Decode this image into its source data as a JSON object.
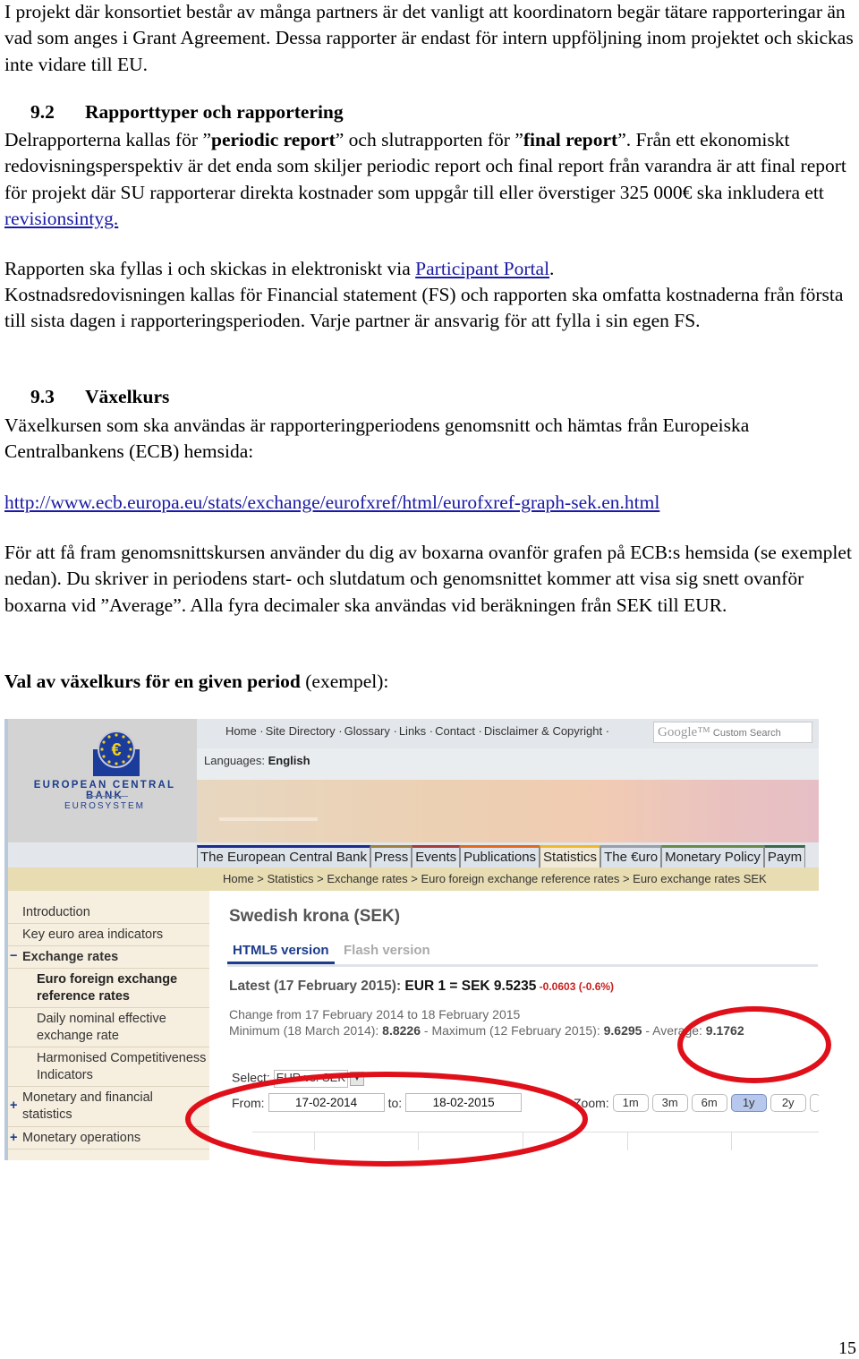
{
  "intro": "I projekt där konsortiet består av många partners är det vanligt att koordinatorn begär tätare rapporteringar än vad som anges i Grant Agreement. Dessa rapporter är endast för intern uppföljning inom projektet och skickas inte vidare till EU.",
  "section_92": {
    "number": "9.2",
    "title": "Rapporttyper och rapportering",
    "p1_a": "Delrapporterna kallas för ”",
    "p1_b": "periodic report",
    "p1_c": "” och slutrapporten för ”",
    "p1_d": "final report",
    "p1_e": "”. Från ett ekonomiskt redovisningsperspektiv är det enda som skiljer periodic report och final report från varandra är att final report för projekt där SU rapporterar direkta kostnader som uppgår till eller överstiger 325 000€ ska inkludera ett ",
    "p1_link": "revisionsintyg.",
    "p2_a": "Rapporten ska fyllas i och skickas in elektroniskt via ",
    "p2_link": "Participant Portal",
    "p2_b": ".",
    "p3": "Kostnadsredovisningen kallas för Financial statement (FS) och rapporten ska omfatta kostnaderna från första till sista dagen i rapporteringsperioden. Varje partner är ansvarig för att fylla i sin egen FS."
  },
  "section_93": {
    "number": "9.3",
    "title": "Växelkurs",
    "p1": "Växelkursen som ska användas är rapporteringperiodens genomsnitt och hämtas från Europeiska Centralbankens (ECB) hemsida:",
    "url": "http://www.ecb.europa.eu/stats/exchange/eurofxref/html/eurofxref-graph-sek.en.html",
    "p2": "För att få fram genomsnittskursen använder du dig av boxarna ovanför grafen på ECB:s hemsida (se exemplet nedan). Du skriver in periodens start- och slutdatum och genomsnittet kommer att visa sig snett ovanför boxarna vid ”Average”. Alla fyra decimaler ska användas vid beräkningen från SEK till EUR.",
    "example_bold": "Val av växelkurs för en given period",
    "example_rest": " (exempel):"
  },
  "ecb": {
    "logo_name": "EUROPEAN CENTRAL BANK",
    "logo_sub": "EUROSYSTEM",
    "top_links": [
      "Home ·",
      "Site Directory ·",
      "Glossary ·",
      "Links ·",
      "Contact ·",
      "Disclaimer & Copyright ·"
    ],
    "search_brand": "Google™",
    "search_placeholder": "Custom Search",
    "languages_label": "Languages:",
    "language": "English",
    "tabs": [
      {
        "label": "The European Central Bank",
        "color": "#1c2c8c"
      },
      {
        "label": "Press",
        "color": "#a08040"
      },
      {
        "label": "Events",
        "color": "#a83a3a"
      },
      {
        "label": "Publications",
        "color": "#e06a1a"
      },
      {
        "label": "Statistics",
        "color": "#f0b828",
        "active": true
      },
      {
        "label": "The €uro",
        "color": "#9aa0a8"
      },
      {
        "label": "Monetary Policy",
        "color": "#6a8a4a"
      },
      {
        "label": "Paym",
        "color": "#3a6a4a"
      }
    ],
    "breadcrumb": "Home > Statistics > Exchange rates > Euro foreign exchange reference rates > Euro exchange rates SEK",
    "sidebar": [
      {
        "label": "Introduction",
        "mark": ""
      },
      {
        "label": "Key euro area indicators",
        "mark": ""
      },
      {
        "label": "Exchange rates",
        "mark": "−",
        "bold": true
      },
      {
        "label": "Euro foreign exchange reference rates",
        "mark": "",
        "bold": true,
        "indent": true
      },
      {
        "label": "Daily nominal effective exchange rate",
        "mark": "",
        "indent": true
      },
      {
        "label": "Harmonised Competitiveness Indicators",
        "mark": "",
        "indent": true
      },
      {
        "label": "Monetary and financial statistics",
        "mark": "+"
      },
      {
        "label": "Monetary operations",
        "mark": "+"
      }
    ],
    "currency_title": "Swedish krona (SEK)",
    "version_tabs": [
      "HTML5 version",
      "Flash version"
    ],
    "latest_label": "Latest (17 February 2015): ",
    "latest_value": "EUR 1 = SEK 9.5235",
    "latest_change": " -0.0603 (-0.6%)",
    "change_period": "Change from 17 February 2014 to 18 February 2015",
    "min_label": "Minimum (18 March 2014): ",
    "min_value": "8.8226",
    "max_label": " - Maximum (12 February 2015): ",
    "max_value": "9.6295",
    "avg_label": " - Average: ",
    "avg_value": "9.1762",
    "select_label": "Select:",
    "select_value": "EUR vs. SEK",
    "from_label": "From:",
    "from_value": "17-02-2014",
    "to_label": "to:",
    "to_value": "18-02-2015",
    "zoom_label": "Zoom:",
    "zoom_buttons": [
      {
        "label": "1m"
      },
      {
        "label": "3m"
      },
      {
        "label": "6m"
      },
      {
        "label": "1y",
        "active": true
      },
      {
        "label": "2y"
      }
    ]
  },
  "annotation_color": "#e0101a",
  "page_number": "15"
}
